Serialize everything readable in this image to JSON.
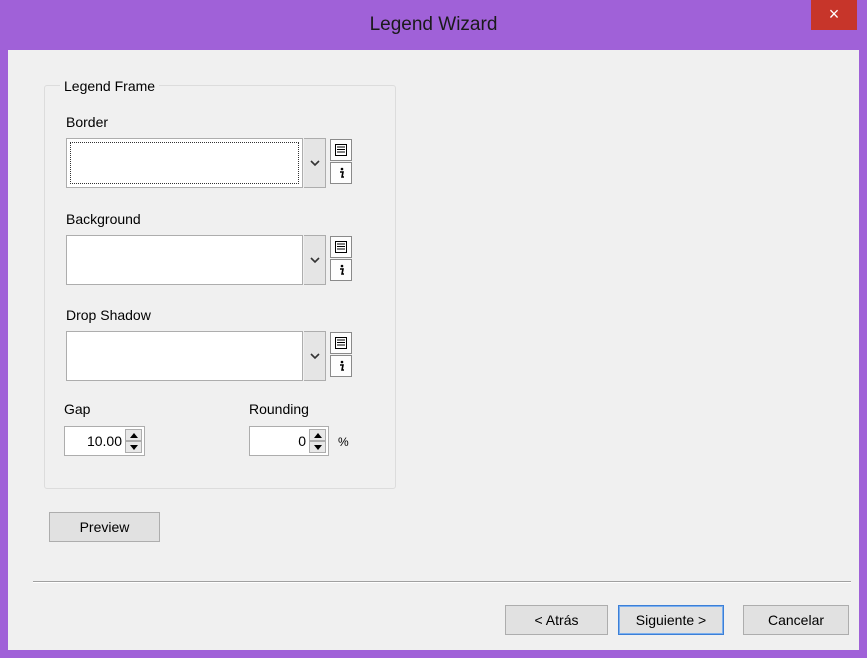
{
  "window": {
    "title": "Legend Wizard",
    "close_glyph": "×"
  },
  "frame": {
    "title": "Legend Frame",
    "border": {
      "label": "Border"
    },
    "background": {
      "label": "Background"
    },
    "drop_shadow": {
      "label": "Drop Shadow"
    },
    "gap": {
      "label": "Gap",
      "value": "10.00"
    },
    "rounding": {
      "label": "Rounding",
      "value": "0",
      "unit": "%"
    }
  },
  "buttons": {
    "preview": "Preview",
    "back": "< Atrás",
    "next": "Siguiente >",
    "cancel": "Cancelar"
  },
  "colors": {
    "titlebar": "#a061d8",
    "client": "#f0f0f0",
    "close": "#c7352a"
  },
  "icons": [
    "close-icon",
    "chevron-down-icon",
    "list-icon",
    "info-icon",
    "arrow-up-icon",
    "arrow-down-icon"
  ]
}
